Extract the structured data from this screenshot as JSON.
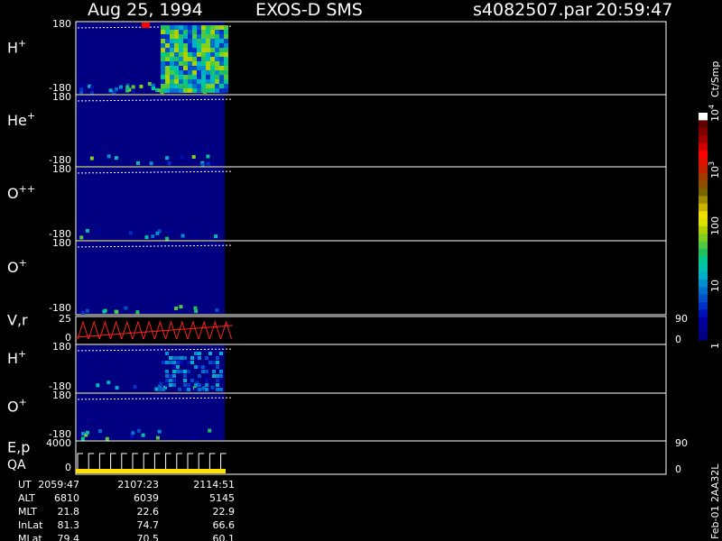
{
  "header": {
    "date": "Aug 25, 1994",
    "instrument": "EXOS-D SMS",
    "file": "s4082507.par",
    "time": "20:59:47"
  },
  "colorbar": {
    "unit_label": "Ct/Smp",
    "ticks": [
      "1",
      "10",
      "100",
      "10",
      "10"
    ],
    "tick_exponents": [
      "",
      "",
      "",
      "3",
      "4"
    ],
    "colors": [
      "#000080",
      "#00008e",
      "#0000a0",
      "#0010b4",
      "#0030c4",
      "#0050c8",
      "#0070cc",
      "#0090d0",
      "#00b0c8",
      "#00c0b0",
      "#00c890",
      "#20c060",
      "#50c840",
      "#80d020",
      "#b0d000",
      "#e0e000",
      "#f0e000",
      "#c8b400",
      "#a08c00",
      "#786400",
      "#8c5000",
      "#a03c00",
      "#c02000",
      "#e01000",
      "#ff0000",
      "#d00000",
      "#a00000",
      "#800000",
      "#600000",
      "#ffffff"
    ],
    "log_range": [
      0,
      4
    ]
  },
  "footer": {
    "labels": [
      "UT",
      "ALT",
      "MLT",
      "InLat",
      "MLat"
    ],
    "columns": [
      [
        "2059:47",
        "6810",
        "21.8",
        "81.3",
        "79.4"
      ],
      [
        "2107:23",
        "6039",
        "22.6",
        "74.7",
        "70.5"
      ],
      [
        "2114:51",
        "5145",
        "22.9",
        "66.6",
        "60.1"
      ]
    ],
    "side_label": "Feb-01 2AA32L"
  },
  "chart_data": {
    "type": "heatmap",
    "panels": [
      {
        "label": "H",
        "sup": "+",
        "yticks": [
          "180",
          "-180"
        ]
      },
      {
        "label": "He",
        "sup": "+",
        "yticks": [
          "180",
          "-180"
        ]
      },
      {
        "label": "O",
        "sup": "++",
        "yticks": [
          "180",
          "-180"
        ]
      },
      {
        "label": "O",
        "sup": "+",
        "yticks": [
          "180",
          "-180"
        ]
      },
      {
        "label": "V,r",
        "sup": "",
        "yticks": [
          "25",
          "0"
        ],
        "right_ticks": [
          "90",
          "0"
        ]
      },
      {
        "label": "H",
        "sup": "+",
        "yticks": [
          "180",
          "-180"
        ]
      },
      {
        "label": "O",
        "sup": "+",
        "yticks": [
          "180",
          "-180"
        ]
      },
      {
        "label": "E,p",
        "sup": "",
        "label2": "QA",
        "yticks": [
          "4000",
          "0"
        ],
        "right_ticks": [
          "90",
          "0"
        ]
      }
    ],
    "time_ticks": [
      "2059:47",
      "2107:23",
      "2114:51"
    ]
  }
}
